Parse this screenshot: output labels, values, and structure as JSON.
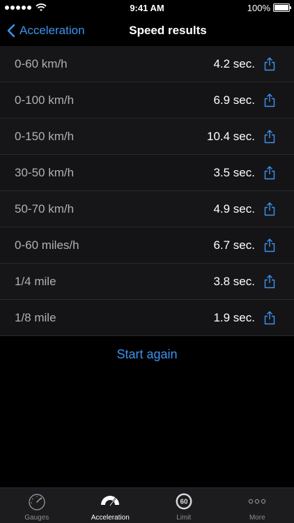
{
  "status_bar": {
    "time": "9:41 AM",
    "battery": "100%"
  },
  "nav": {
    "back_label": "Acceleration",
    "title": "Speed results"
  },
  "results": [
    {
      "label": "0-60 km/h",
      "value": "4.2 sec."
    },
    {
      "label": "0-100 km/h",
      "value": "6.9 sec."
    },
    {
      "label": "0-150 km/h",
      "value": "10.4 sec."
    },
    {
      "label": "30-50 km/h",
      "value": "3.5 sec."
    },
    {
      "label": "50-70 km/h",
      "value": "4.9 sec."
    },
    {
      "label": "0-60 miles/h",
      "value": "6.7 sec."
    },
    {
      "label": "1/4 mile",
      "value": "3.8 sec."
    },
    {
      "label": "1/8 mile",
      "value": "1.9 sec."
    }
  ],
  "start_again_label": "Start again",
  "tabs": [
    {
      "label": "Gauges",
      "icon": "speedometer-icon"
    },
    {
      "label": "Acceleration",
      "icon": "acceleration-icon"
    },
    {
      "label": "Limit",
      "icon": "speed-limit-icon",
      "icon_text": "60"
    },
    {
      "label": "More",
      "icon": "more-icon"
    }
  ],
  "colors": {
    "accent": "#3d93f0",
    "background": "#000000",
    "row_bg": "#141416"
  }
}
